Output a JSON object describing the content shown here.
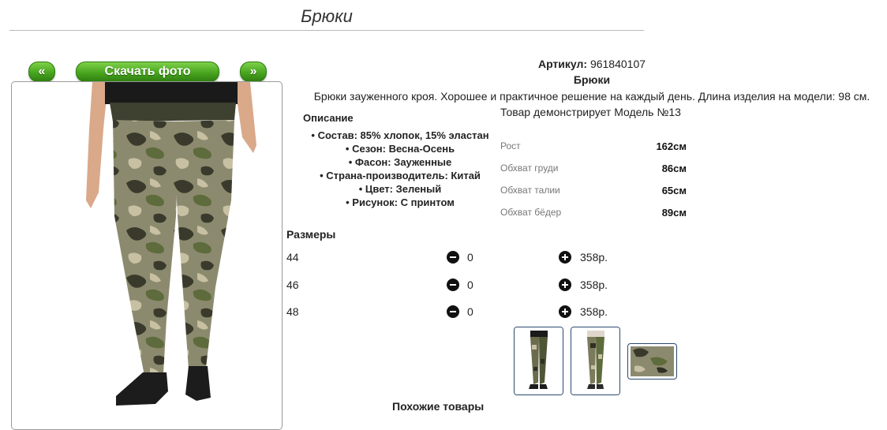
{
  "page": {
    "title": "Брюки"
  },
  "gallery": {
    "prev_label": "«",
    "download_label": "Скачать фото",
    "next_label": "»"
  },
  "product": {
    "article_label": "Артикул:",
    "article_value": "961840107",
    "name": "Брюки",
    "description": "Брюки зауженного кроя. Хорошее и практичное решение на каждый день. Длина изделия на модели: 98 см.",
    "model_line": "Товар демонстрирует Модель №13"
  },
  "specs": {
    "heading": "Описание",
    "items": [
      "Состав: 85% хлопок, 15% эластан",
      "Сезон: Весна-Осень",
      "Фасон: Зауженные",
      "Страна-производитель: Китай",
      "Цвет: Зеленый",
      "Рисунок: С принтом"
    ]
  },
  "measurements": [
    {
      "label": "Рост",
      "value": "162см"
    },
    {
      "label": "Обхват груди",
      "value": "86см"
    },
    {
      "label": "Обхват талии",
      "value": "65см"
    },
    {
      "label": "Обхват бёдер",
      "value": "89см"
    }
  ],
  "sizes": {
    "heading": "Размеры",
    "rows": [
      {
        "size": "44",
        "qty": "0",
        "price": "358р."
      },
      {
        "size": "46",
        "qty": "0",
        "price": "358р."
      },
      {
        "size": "48",
        "qty": "0",
        "price": "358р."
      }
    ]
  },
  "similar_heading": "Похожие товары",
  "colors": {
    "button_green": "#49a51f",
    "camo_base": "#8c8a6e",
    "camo_dark": "#3a3a2c",
    "camo_olive": "#5e6b3c",
    "camo_light": "#c7c0a2"
  }
}
